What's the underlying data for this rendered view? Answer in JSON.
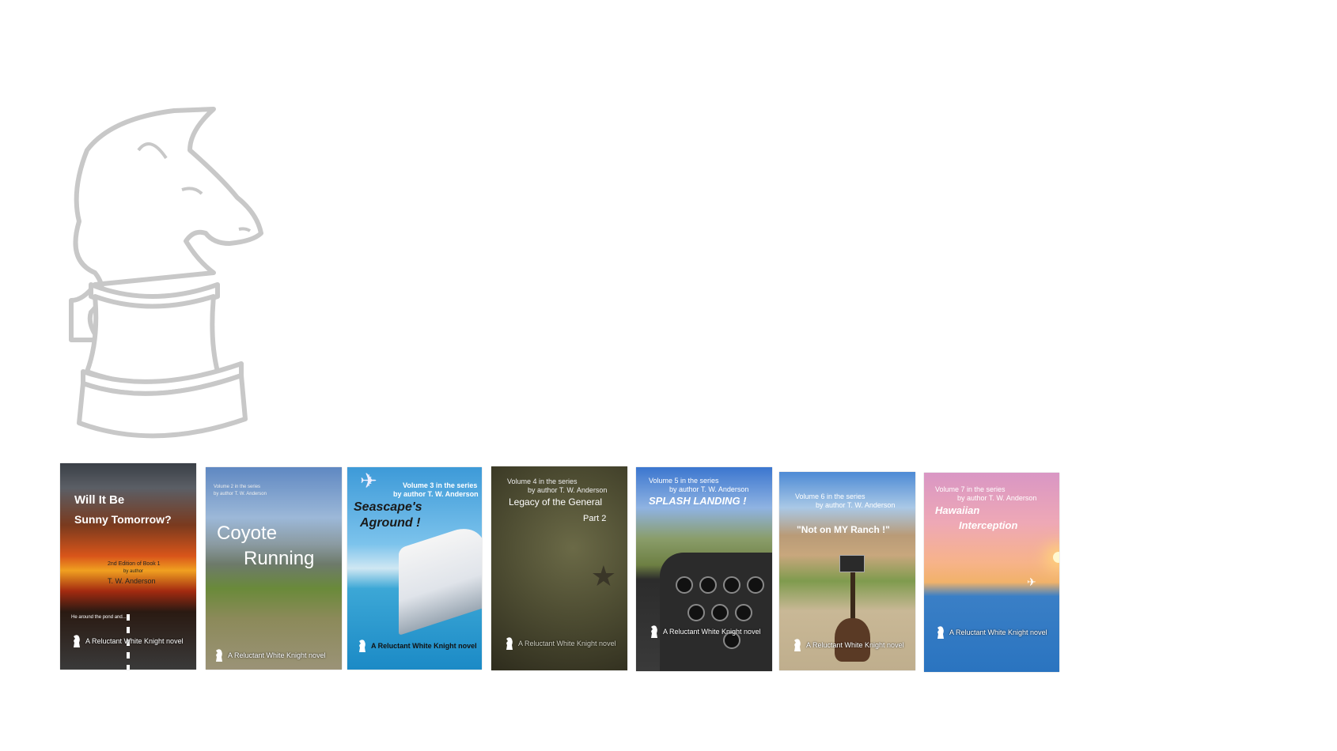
{
  "logo": {
    "icon": "chess-knight-outline",
    "stroke_color": "#cfcfcf"
  },
  "covers": [
    {
      "title_lines": [
        "Will It Be",
        "Sunny Tomorrow?"
      ],
      "edition": "2nd Edition of Book 1",
      "byline": "by author",
      "author": "T. W. Anderson",
      "blurb": "He around the pond and...",
      "imprint": "A Reluctant White Knight novel"
    },
    {
      "series": "Volume 2 in the series",
      "byline": "by author T. W. Anderson",
      "title_lines": [
        "Coyote",
        "Running"
      ],
      "imprint": "A Reluctant White Knight novel"
    },
    {
      "series": "Volume 3 in the series",
      "byline": "by author T. W. Anderson",
      "title_lines": [
        "Seascape's",
        "Aground !"
      ],
      "imprint": "A Reluctant White Knight novel"
    },
    {
      "series": "Volume 4 in the series",
      "byline": "by author T. W. Anderson",
      "title_lines": [
        "Legacy of the General",
        "Part 2"
      ],
      "imprint": "A Reluctant White Knight novel"
    },
    {
      "series": "Volume 5 in the series",
      "byline": "by author T. W. Anderson",
      "title_lines": [
        "SPLASH LANDING !"
      ],
      "imprint": "A Reluctant White Knight novel"
    },
    {
      "series": "Volume 6 in the series",
      "byline": "by author T. W. Anderson",
      "title_lines": [
        "\"Not on MY Ranch !\""
      ],
      "imprint": "A Reluctant White Knight novel"
    },
    {
      "series": "Volume 7 in the series",
      "byline": "by author T. W. Anderson",
      "title_lines": [
        "Hawaiian",
        "Interception"
      ],
      "imprint": "A Reluctant White Knight novel"
    }
  ]
}
